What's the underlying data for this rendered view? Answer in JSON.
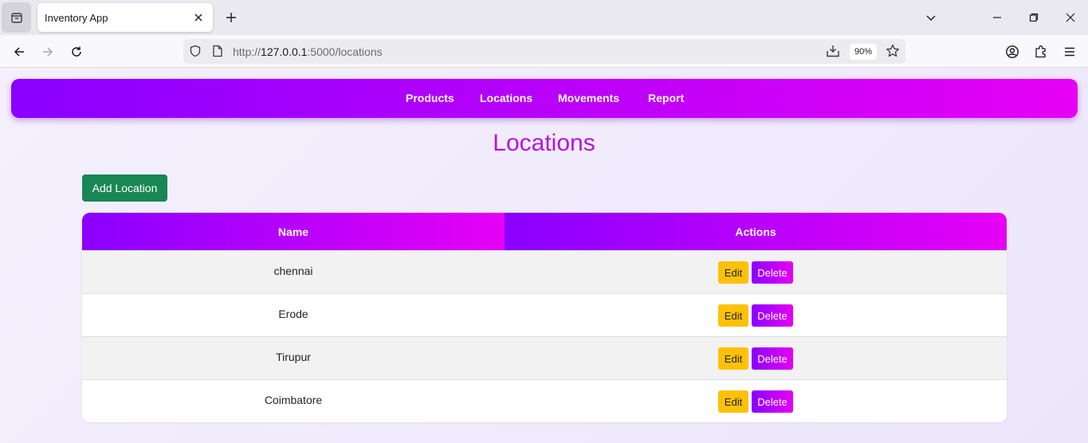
{
  "browser": {
    "tab_title": "Inventory App",
    "url_prefix": "http://",
    "url_host": "127.0.0.1",
    "url_rest": ":5000/locations",
    "zoom": "90%"
  },
  "nav": {
    "links": [
      "Products",
      "Locations",
      "Movements",
      "Report"
    ]
  },
  "page": {
    "title": "Locations",
    "add_button": "Add Location"
  },
  "table": {
    "headers": [
      "Name",
      "Actions"
    ],
    "rows": [
      {
        "name": "chennai",
        "edit": "Edit",
        "delete": "Delete"
      },
      {
        "name": "Erode",
        "edit": "Edit",
        "delete": "Delete"
      },
      {
        "name": "Tirupur",
        "edit": "Edit",
        "delete": "Delete"
      },
      {
        "name": "Coimbatore",
        "edit": "Edit",
        "delete": "Delete"
      }
    ]
  },
  "colors": {
    "gradient_start": "#8a00ff",
    "gradient_end": "#e600f5",
    "add_button": "#198754",
    "edit_button": "#ffc107",
    "title": "#b414e0"
  }
}
